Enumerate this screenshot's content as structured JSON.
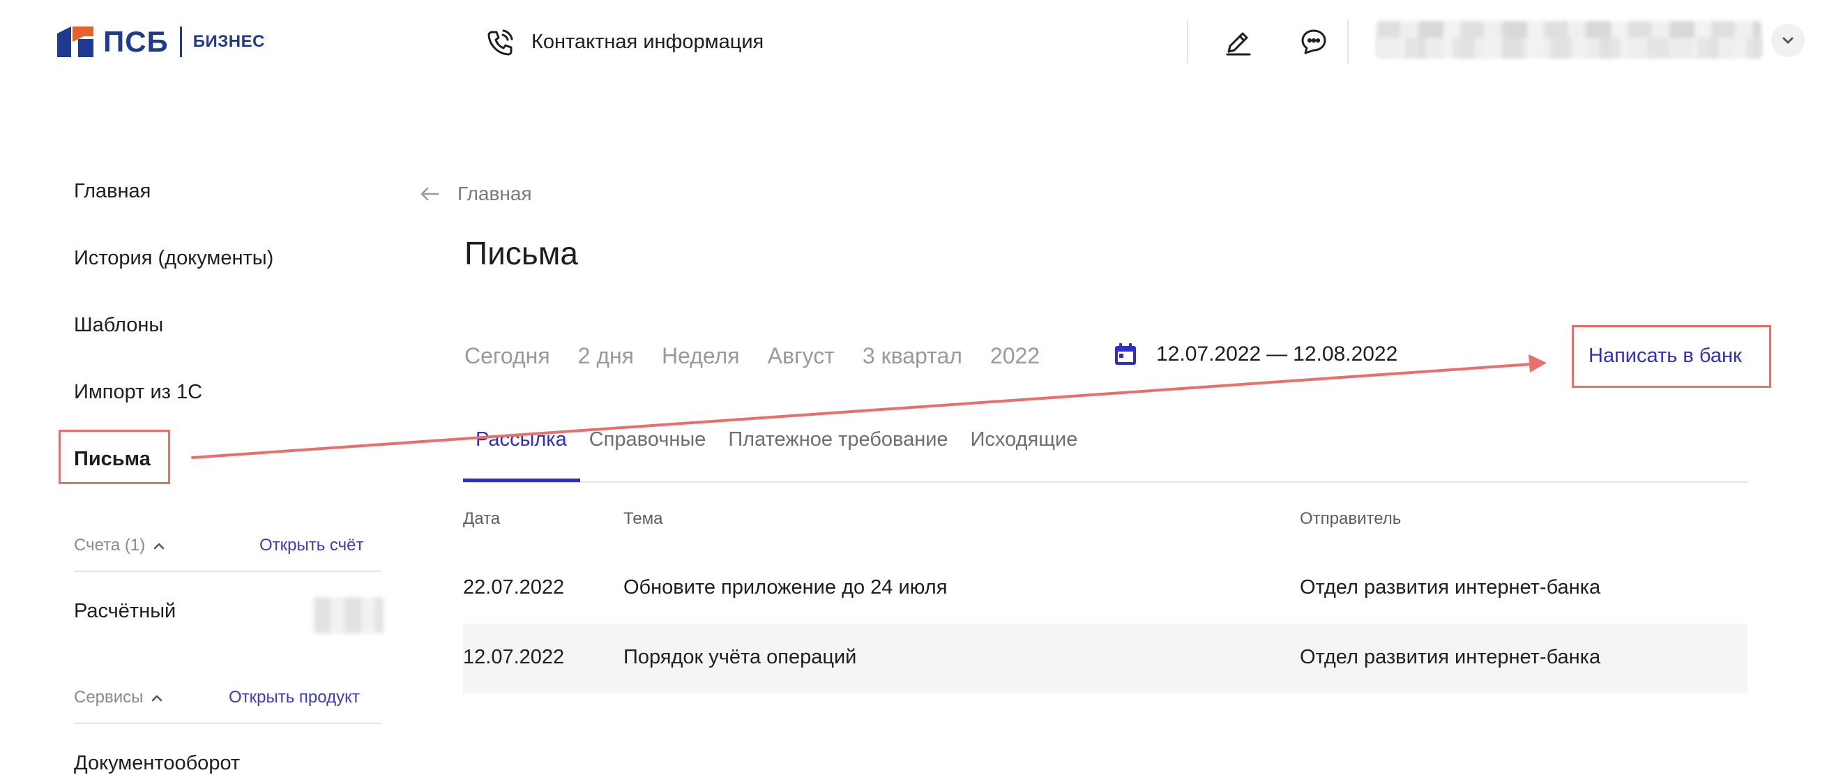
{
  "header": {
    "logo_text": "ПСБ",
    "logo_sub": "БИЗНЕС",
    "contact_label": "Контактная информация",
    "icons": [
      "phone-icon",
      "edit-icon",
      "chat-icon",
      "chevron-down-icon"
    ]
  },
  "sidebar": {
    "items": [
      {
        "label": "Главная"
      },
      {
        "label": "История (документы)"
      },
      {
        "label": "Шаблоны"
      },
      {
        "label": "Импорт из 1С"
      },
      {
        "label": "Письма",
        "active": true
      }
    ],
    "accounts": {
      "label": "Счета (1)",
      "link": "Открыть счёт",
      "item": "Расчётный"
    },
    "services": {
      "label": "Сервисы",
      "link": "Открыть продукт",
      "item": "Документооборот"
    }
  },
  "main": {
    "back_label": "Главная",
    "title": "Письма",
    "periods": [
      "Сегодня",
      "2 дня",
      "Неделя",
      "Август",
      "3 квартал",
      "2022"
    ],
    "date_from": "12.07.2022",
    "date_sep": "—",
    "date_to": "12.08.2022",
    "write_link": "Написать в банк",
    "tabs": [
      "Рассылка",
      "Справочные",
      "Платежное требование",
      "Исходящие"
    ],
    "table": {
      "headers": [
        "Дата",
        "Тема",
        "Отправитель"
      ],
      "rows": [
        [
          "22.07.2022",
          "Обновите приложение до 24 июля",
          "Отдел развития интернет-банка"
        ],
        [
          "12.07.2022",
          "Порядок учёта операций",
          "Отдел развития интернет-банка"
        ]
      ]
    }
  },
  "colors": {
    "accent": "#2f2fc6",
    "brand": "#1f3b8f",
    "brand_orange": "#e8602c",
    "annotation": "#ea6f6b"
  }
}
